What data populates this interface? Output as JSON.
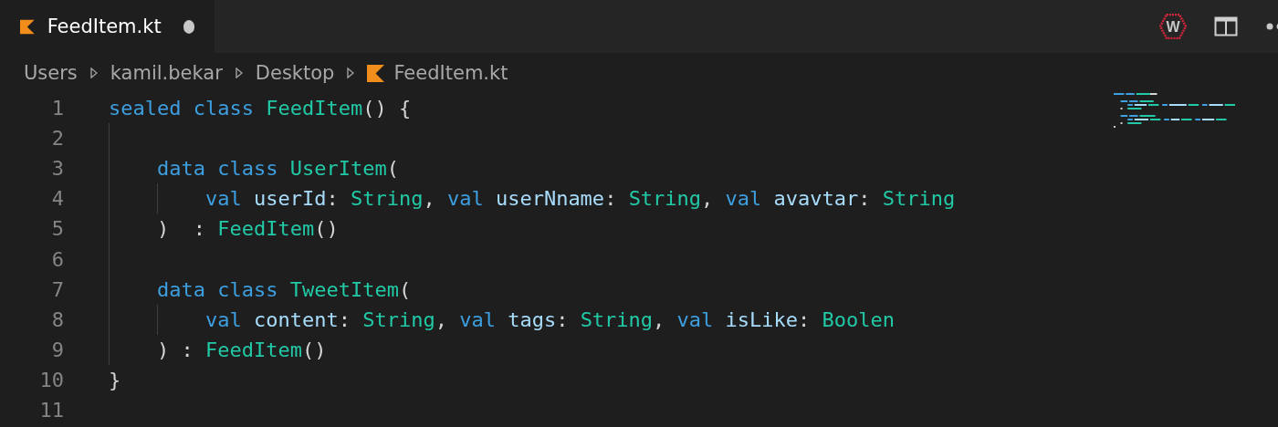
{
  "tabs": [
    {
      "label": "FeedItem.kt",
      "selected": true,
      "modified": true
    }
  ],
  "toolbar": {
    "extension_badge": "W"
  },
  "breadcrumbs": [
    "Users",
    "kamil.bekar",
    "Desktop",
    "FeedItem.kt"
  ],
  "code_lines": [
    {
      "number": "1",
      "tokens": [
        {
          "kind": "keyword",
          "text": "sealed "
        },
        {
          "kind": "keyword",
          "text": "class "
        },
        {
          "kind": "type",
          "text": "FeedItem"
        },
        {
          "kind": "plain",
          "text": "() {"
        }
      ]
    },
    {
      "number": "2"
    },
    {
      "number": "3",
      "tokens": [
        {
          "kind": "keyword",
          "text": "    data "
        },
        {
          "kind": "keyword",
          "text": "class "
        },
        {
          "kind": "type",
          "text": "UserItem"
        },
        {
          "kind": "plain",
          "text": "("
        }
      ]
    },
    {
      "number": "4",
      "tokens": [
        {
          "kind": "keyword",
          "text": "        val "
        },
        {
          "kind": "ident",
          "text": "userId"
        },
        {
          "kind": "plain",
          "text": ": "
        },
        {
          "kind": "type",
          "text": "String"
        },
        {
          "kind": "plain",
          "text": ", "
        },
        {
          "kind": "keyword",
          "text": "val "
        },
        {
          "kind": "ident",
          "text": "userNname"
        },
        {
          "kind": "plain",
          "text": ": "
        },
        {
          "kind": "type",
          "text": "String"
        },
        {
          "kind": "plain",
          "text": ", "
        },
        {
          "kind": "keyword",
          "text": "val "
        },
        {
          "kind": "ident",
          "text": "avavtar"
        },
        {
          "kind": "plain",
          "text": ": "
        },
        {
          "kind": "type",
          "text": "String"
        }
      ]
    },
    {
      "number": "5",
      "tokens": [
        {
          "kind": "plain",
          "text": "    )  : "
        },
        {
          "kind": "type",
          "text": "FeedItem"
        },
        {
          "kind": "plain",
          "text": "()"
        }
      ]
    },
    {
      "number": "6"
    },
    {
      "number": "7",
      "tokens": [
        {
          "kind": "keyword",
          "text": "    data "
        },
        {
          "kind": "keyword",
          "text": "class "
        },
        {
          "kind": "type",
          "text": "TweetItem"
        },
        {
          "kind": "plain",
          "text": "("
        }
      ]
    },
    {
      "number": "8",
      "tokens": [
        {
          "kind": "keyword",
          "text": "        val "
        },
        {
          "kind": "ident",
          "text": "content"
        },
        {
          "kind": "plain",
          "text": ": "
        },
        {
          "kind": "type",
          "text": "String"
        },
        {
          "kind": "plain",
          "text": ", "
        },
        {
          "kind": "keyword",
          "text": "val "
        },
        {
          "kind": "ident",
          "text": "tags"
        },
        {
          "kind": "plain",
          "text": ": "
        },
        {
          "kind": "type",
          "text": "String"
        },
        {
          "kind": "plain",
          "text": ", "
        },
        {
          "kind": "keyword",
          "text": "val "
        },
        {
          "kind": "ident",
          "text": "isLike"
        },
        {
          "kind": "plain",
          "text": ": "
        },
        {
          "kind": "type",
          "text": "Boolen"
        }
      ]
    },
    {
      "number": "9",
      "tokens": [
        {
          "kind": "plain",
          "text": "    ) : "
        },
        {
          "kind": "type",
          "text": "FeedItem"
        },
        {
          "kind": "plain",
          "text": "()"
        }
      ]
    },
    {
      "number": "10",
      "tokens": [
        {
          "kind": "plain",
          "text": "}"
        }
      ]
    },
    {
      "number": "11"
    }
  ]
}
